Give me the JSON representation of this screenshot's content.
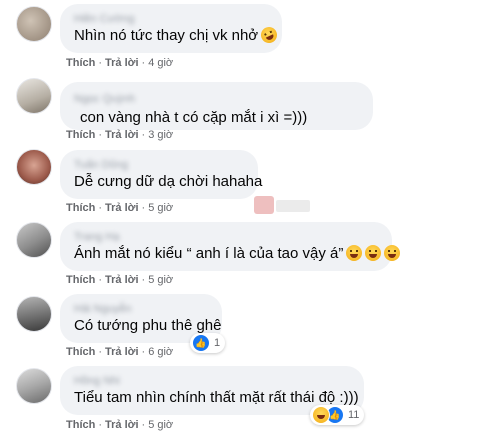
{
  "actions": {
    "like": "Thích",
    "reply": "Trả lời",
    "separator": "·"
  },
  "comments": [
    {
      "author": "Hiền Cường",
      "text": "Nhìn nó tức thay chị vk nhở",
      "emoji": "rofl-emoji",
      "time": "4 giờ"
    },
    {
      "author": "Ngọc Quỳnh",
      "text": "con vàng nhà t có cặp mắt i xì =)))",
      "time": "3 giờ"
    },
    {
      "author": "Tuấn Dũng",
      "text": "Dễ cưng dữ dạ chời hahaha",
      "time": "5 giờ"
    },
    {
      "author": "Trang Hạ",
      "text": "Ánh mắt nó kiểu “ anh í là của tao vậy á”",
      "emoji": "laughing-tears-emoji",
      "time": "5 giờ"
    },
    {
      "author": "Hải Nguyễn",
      "text": "Có tướng phu thê ghê",
      "time": "6 giờ",
      "reactions": {
        "icons": [
          "like-icon"
        ],
        "count": "1"
      }
    },
    {
      "author": "Hồng Nhi",
      "text": "Tiểu tam nhìn chính thất mặt rất thái độ :)))",
      "time": "5 giờ",
      "reactions": {
        "icons": [
          "haha-icon",
          "like-icon"
        ],
        "count": "11"
      }
    }
  ],
  "colors": {
    "bubble": "#f0f2f5",
    "text": "#050505",
    "meta": "#65676b",
    "like_blue": "#1877f2"
  }
}
